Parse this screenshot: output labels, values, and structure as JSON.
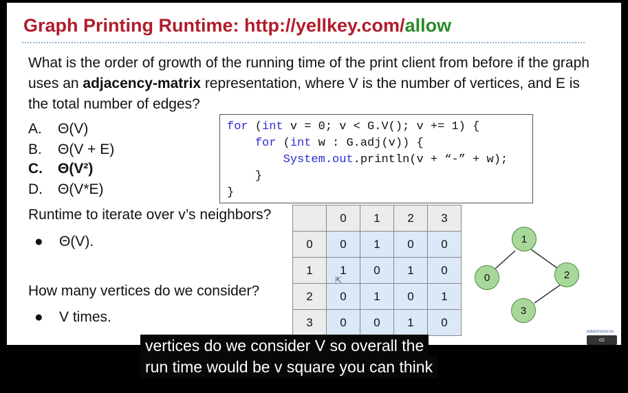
{
  "slide": {
    "title_prefix": "Graph Printing Runtime: http://yellkey.com/",
    "title_suffix": "allow",
    "question_pre": "What is the order of growth of the running time of the print client from before if the graph uses an ",
    "question_bold": "adjacency-matrix",
    "question_post": " representation, where V is the number of vertices, and E is the total number of edges?",
    "options": [
      {
        "letter": "A.",
        "text": "Θ(V)"
      },
      {
        "letter": "B.",
        "text": "Θ(V + E)"
      },
      {
        "letter": "C.",
        "text": "Θ(V²)"
      },
      {
        "letter": "D.",
        "text": "Θ(V*E)"
      }
    ],
    "code": {
      "line1_kw": "for",
      "line1_a": " (",
      "line1_int": "int",
      "line1_b": " v = 0; v < G.V(); v += 1) {",
      "line2_kw": "for",
      "line2_a": " (",
      "line2_int": "int",
      "line2_b": " w : G.adj(v)) {",
      "line3_sys": "System.out",
      "line3_b": ".println(v + “-” + w);",
      "line4": "}",
      "line5": "}"
    },
    "runtime_question": "Runtime to iterate over v’s neighbors?",
    "runtime_answer": "Θ(V).",
    "vertices_question": "How many vertices do we consider?",
    "vertices_answer": "V times.",
    "matrix": {
      "header": [
        "",
        "0",
        "1",
        "2",
        "3"
      ],
      "rows": [
        {
          "label": "0",
          "cells": [
            "0",
            "1",
            "0",
            "0"
          ]
        },
        {
          "label": "1",
          "cells": [
            "1",
            "0",
            "1",
            "0"
          ]
        },
        {
          "label": "2",
          "cells": [
            "0",
            "1",
            "0",
            "1"
          ]
        },
        {
          "label": "3",
          "cells": [
            "0",
            "0",
            "1",
            "0"
          ]
        }
      ]
    },
    "graph_nodes": [
      "0",
      "1",
      "2",
      "3"
    ],
    "credit": "datastructur.es",
    "license": "cc"
  },
  "captions": {
    "line1": "vertices do we consider V so overall the",
    "line2": "run time would be v square you can think"
  },
  "colors": {
    "title_red": "#b11c2a",
    "title_green": "#2a8a2a",
    "node_fill": "#a8d79a",
    "matrix_cell": "#dbe8f7"
  }
}
